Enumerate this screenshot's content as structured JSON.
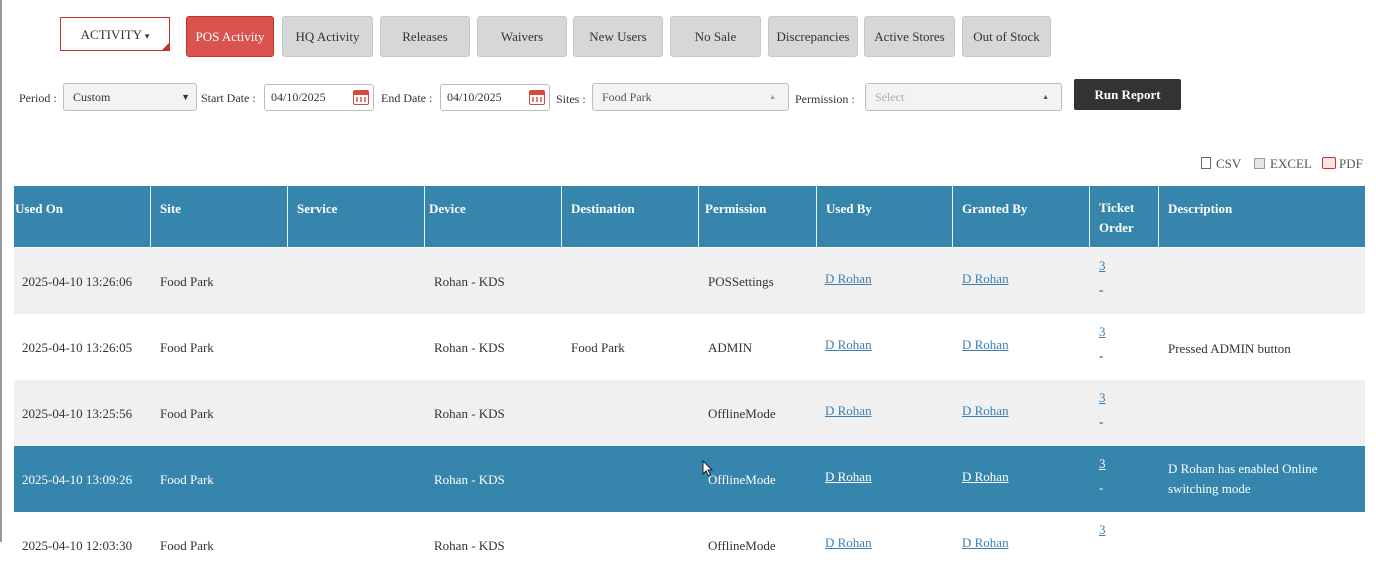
{
  "tabs": {
    "menu_label": "ACTIVITY",
    "menu_caret": "▾",
    "items": [
      {
        "label": "POS Activity",
        "active": true
      },
      {
        "label": "HQ Activity",
        "active": false
      },
      {
        "label": "Releases",
        "active": false
      },
      {
        "label": "Waivers",
        "active": false
      },
      {
        "label": "New Users",
        "active": false
      },
      {
        "label": "No Sale",
        "active": false
      },
      {
        "label": "Discrepancies",
        "active": false
      },
      {
        "label": "Active Stores",
        "active": false
      },
      {
        "label": "Out of Stock",
        "active": false
      }
    ]
  },
  "filters": {
    "period_label": "Period :",
    "period_value": "Custom",
    "start_label": "Start Date :",
    "start_value": "04/10/2025",
    "end_label": "End Date :",
    "end_value": "04/10/2025",
    "sites_label": "Sites :",
    "sites_value": "Food Park",
    "permission_label": "Permission :",
    "permission_placeholder": "Select",
    "run_label": "Run Report"
  },
  "export": {
    "csv": "CSV",
    "excel": "EXCEL",
    "pdf": "PDF"
  },
  "table": {
    "headers": [
      "Used On",
      "Site",
      "Service",
      "Device",
      "Destination",
      "Permission",
      "Used By",
      "Granted By",
      "Ticket Order",
      "Description"
    ],
    "ticket_header_line1": "Ticket",
    "ticket_header_line2": "Order",
    "rows": [
      {
        "used_on": "2025-04-10 13:26:06",
        "site": "Food Park",
        "service": "",
        "device": "Rohan - KDS",
        "destination": "",
        "permission": "POSSettings",
        "used_by": "D Rohan",
        "granted_by": "D Rohan",
        "ticket": "3",
        "dash": "-",
        "description": ""
      },
      {
        "used_on": "2025-04-10 13:26:05",
        "site": "Food Park",
        "service": "",
        "device": "Rohan - KDS",
        "destination": "Food Park",
        "permission": "ADMIN",
        "used_by": "D Rohan",
        "granted_by": "D Rohan",
        "ticket": "3",
        "dash": "-",
        "description": "Pressed ADMIN button"
      },
      {
        "used_on": "2025-04-10 13:25:56",
        "site": "Food Park",
        "service": "",
        "device": "Rohan - KDS",
        "destination": "",
        "permission": "OfflineMode",
        "used_by": "D Rohan",
        "granted_by": "D Rohan",
        "ticket": "3",
        "dash": "-",
        "description": ""
      },
      {
        "used_on": "2025-04-10 13:09:26",
        "site": "Food Park",
        "service": "",
        "device": "Rohan - KDS",
        "destination": "",
        "permission": "OfflineMode",
        "used_by": "D Rohan",
        "granted_by": "D Rohan",
        "ticket": "3",
        "dash": "-",
        "description": "D Rohan has enabled Online switching mode"
      },
      {
        "used_on": "2025-04-10 12:03:30",
        "site": "Food Park",
        "service": "",
        "device": "Rohan - KDS",
        "destination": "",
        "permission": "OfflineMode",
        "used_by": "D Rohan",
        "granted_by": "D Rohan",
        "ticket": "3",
        "dash": "-",
        "description": ""
      }
    ]
  },
  "colors": {
    "header": "#3585ad",
    "accent": "#d9534f",
    "run": "#333333"
  }
}
